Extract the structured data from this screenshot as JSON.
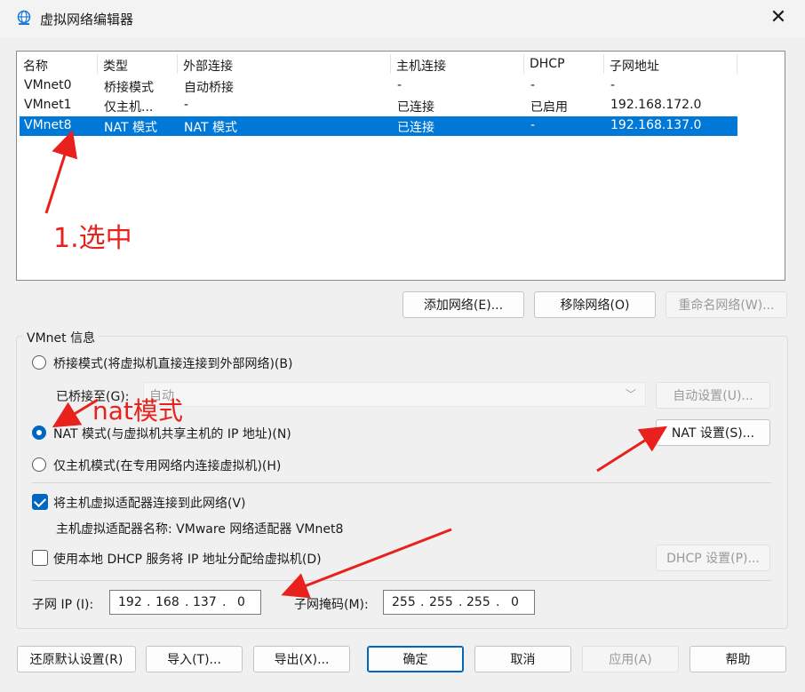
{
  "window": {
    "title": "虚拟网络编辑器",
    "close_icon": "✕"
  },
  "table": {
    "headers": [
      "名称",
      "类型",
      "外部连接",
      "主机连接",
      "DHCP",
      "子网地址"
    ],
    "rows": [
      {
        "name": "VMnet0",
        "type": "桥接模式",
        "external": "自动桥接",
        "host": "-",
        "dhcp": "-",
        "subnet": "-"
      },
      {
        "name": "VMnet1",
        "type": "仅主机...",
        "external": "-",
        "host": "已连接",
        "dhcp": "已启用",
        "subnet": "192.168.172.0"
      },
      {
        "name": "VMnet8",
        "type": "NAT 模式",
        "external": "NAT 模式",
        "host": "已连接",
        "dhcp": "-",
        "subnet": "192.168.137.0",
        "selected": true
      }
    ]
  },
  "list_buttons": {
    "add": "添加网络(E)...",
    "remove": "移除网络(O)",
    "rename": "重命名网络(W)..."
  },
  "vmnet_info": {
    "legend": "VMnet 信息",
    "bridge_radio": "桥接模式(将虚拟机直接连接到外部网络)(B)",
    "bridged_to_label": "已桥接至(G):",
    "bridged_to_value": "自动",
    "auto_settings": "自动设置(U)...",
    "nat_radio": "NAT 模式(与虚拟机共享主机的 IP 地址)(N)",
    "nat_settings": "NAT 设置(S)...",
    "hostonly_radio": "仅主机模式(在专用网络内连接虚拟机)(H)",
    "connect_adapter": "将主机虚拟适配器连接到此网络(V)",
    "adapter_name": "主机虚拟适配器名称: VMware 网络适配器 VMnet8",
    "use_dhcp": "使用本地 DHCP 服务将 IP 地址分配给虚拟机(D)",
    "dhcp_settings": "DHCP 设置(P)...",
    "subnet_ip_label": "子网 IP (I):",
    "subnet_ip": [
      "192",
      "168",
      "137",
      "0"
    ],
    "subnet_mask_label": "子网掩码(M):",
    "subnet_mask": [
      "255",
      "255",
      "255",
      "0"
    ]
  },
  "footer_buttons": {
    "restore": "还原默认设置(R)",
    "import": "导入(T)...",
    "export": "导出(X)...",
    "ok": "确定",
    "cancel": "取消",
    "apply": "应用(A)",
    "help": "帮助"
  },
  "annotations": {
    "select": "1.选中",
    "nat": "nat模式"
  },
  "colors": {
    "selection": "#0078d7",
    "accent": "#0067c0",
    "annotation": "#e8211d"
  }
}
